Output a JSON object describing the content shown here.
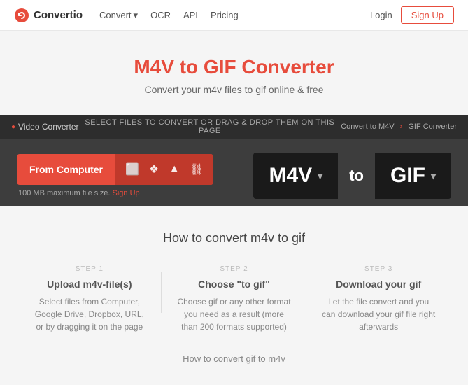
{
  "nav": {
    "logo_text": "Convertio",
    "links": [
      {
        "label": "Convert",
        "has_arrow": true
      },
      {
        "label": "OCR"
      },
      {
        "label": "API"
      },
      {
        "label": "Pricing"
      }
    ],
    "login": "Login",
    "signup": "Sign Up"
  },
  "hero": {
    "title": "M4V to GIF Converter",
    "subtitle": "Convert your m4v files to gif online & free"
  },
  "converter": {
    "topbar_left_label": "Video Converter",
    "topbar_center": "SELECT FILES TO CONVERT OR DRAG & DROP THEM ON THIS PAGE",
    "topbar_right_convert": "Convert to M4V",
    "topbar_right_sep": "›",
    "topbar_right_current": "GIF Converter",
    "upload_btn": "From Computer",
    "file_size": "100 MB maximum file size.",
    "signup_link": "Sign Up",
    "format_from": "M4V",
    "format_to_label": "to",
    "format_to": "GIF"
  },
  "howto": {
    "title": "How to convert m4v to gif",
    "steps": [
      {
        "number": "STEP 1",
        "title": "Upload m4v-file(s)",
        "desc": "Select files from Computer, Google Drive, Dropbox, URL, or by dragging it on the page"
      },
      {
        "number": "STEP 2",
        "title": "Choose \"to gif\"",
        "desc": "Choose gif or any other format you need as a result (more than 200 formats supported)"
      },
      {
        "number": "STEP 3",
        "title": "Download your gif",
        "desc": "Let the file convert and you can download your gif file right afterwards"
      }
    ],
    "bottom_link": "How to convert gif to m4v"
  }
}
